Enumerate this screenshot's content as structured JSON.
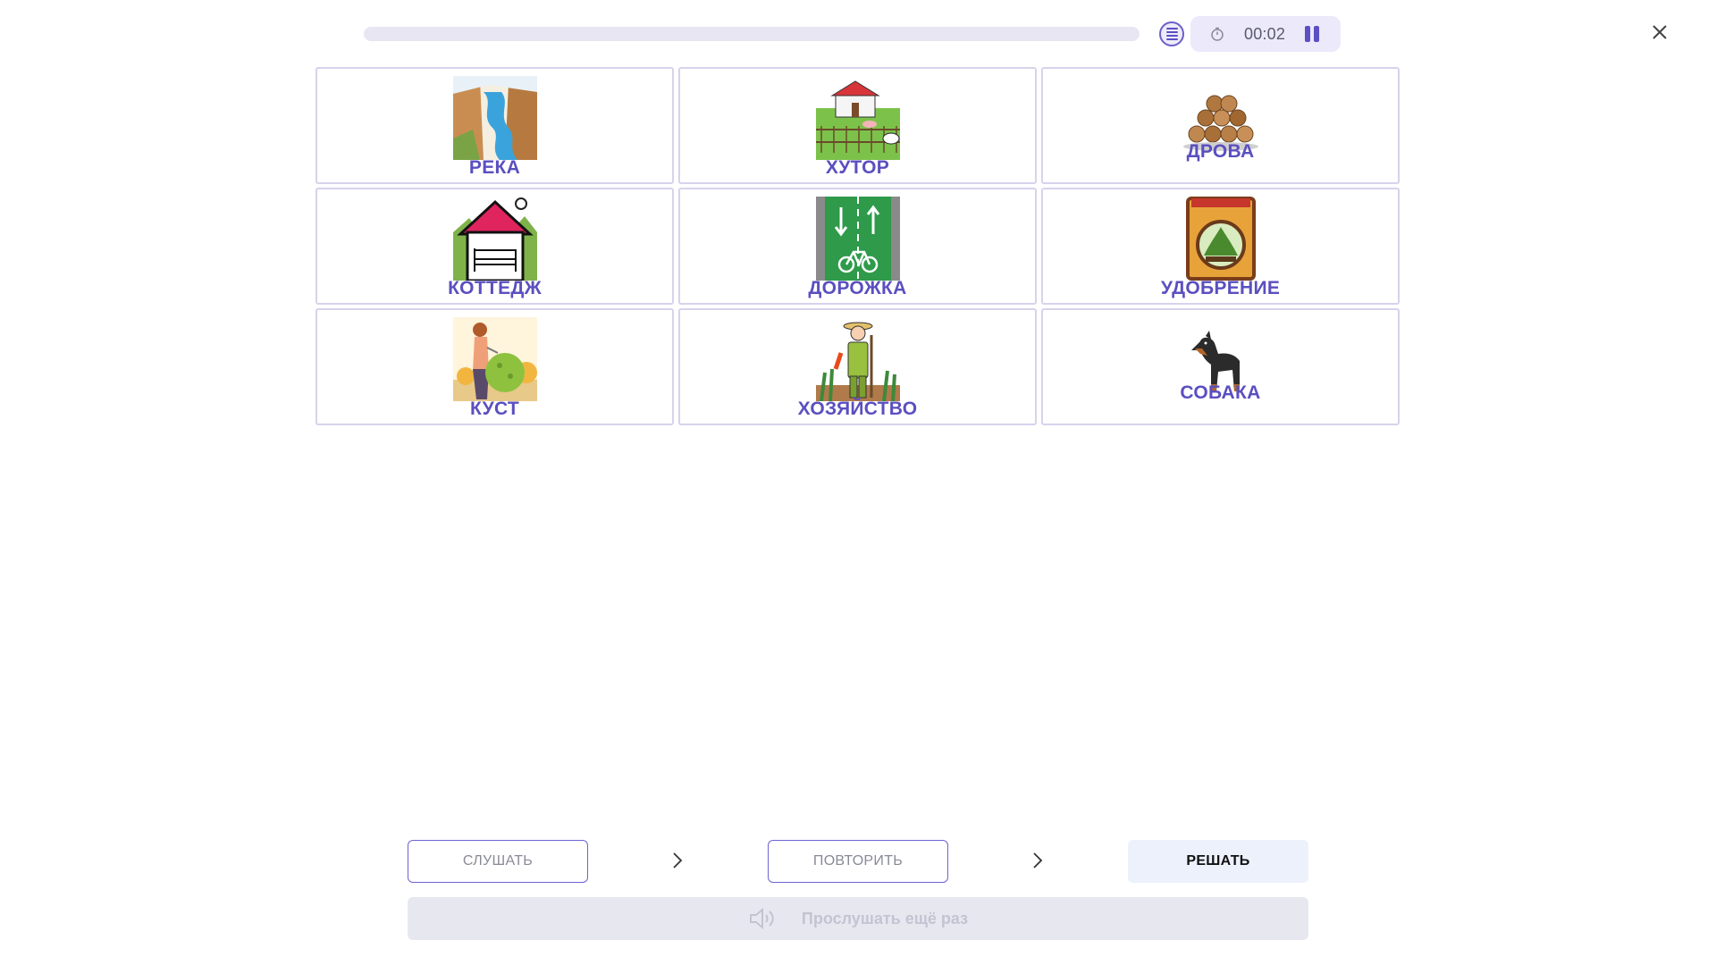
{
  "header": {
    "progress": 0,
    "timer": "00:02"
  },
  "cards": [
    {
      "label": "РЕКА",
      "icon": "river-icon"
    },
    {
      "label": "ХУТОР",
      "icon": "farmstead-icon"
    },
    {
      "label": "ДРОВА",
      "icon": "firewood-icon"
    },
    {
      "label": "КОТТЕДЖ",
      "icon": "cottage-icon"
    },
    {
      "label": "ДОРОЖКА",
      "icon": "bike-path-icon"
    },
    {
      "label": "УДОБРЕНИЕ",
      "icon": "fertilizer-icon"
    },
    {
      "label": "КУСТ",
      "icon": "bush-icon"
    },
    {
      "label": "ХОЗЯЙСТВО",
      "icon": "farmer-icon"
    },
    {
      "label": "СОБАКА",
      "icon": "dog-icon"
    }
  ],
  "controls": {
    "listen_label": "СЛУШАТЬ",
    "repeat_label": "ПОВТОРИТЬ",
    "solve_label": "РЕШАТЬ",
    "replay_label": "Прослушать ещё раз"
  },
  "colors": {
    "accent": "#5a4fc0",
    "card_border": "#d6d3ec",
    "progress_track": "#e8e6f2",
    "solve_bg": "#ecf1fc",
    "replay_bg": "#e7e8ef"
  }
}
